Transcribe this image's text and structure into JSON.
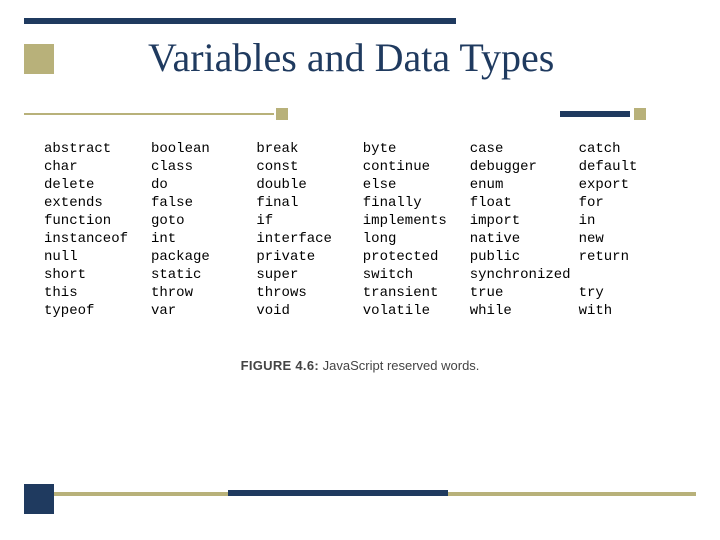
{
  "title": "Variables and Data Types",
  "figure": {
    "label": "FIGURE 4.6:",
    "caption": "JavaScript reserved words."
  },
  "chart_data": {
    "type": "table",
    "title": "JavaScript reserved words",
    "columns": 6,
    "rows": [
      [
        "abstract",
        "boolean",
        "break",
        "byte",
        "case",
        "catch"
      ],
      [
        "char",
        "class",
        "const",
        "continue",
        "debugger",
        "default"
      ],
      [
        "delete",
        "do",
        "double",
        "else",
        "enum",
        "export"
      ],
      [
        "extends",
        "false",
        "final",
        "finally",
        "float",
        "for"
      ],
      [
        "function",
        "goto",
        "if",
        "implements",
        "import",
        "in"
      ],
      [
        "instanceof",
        "int",
        "interface",
        "long",
        "native",
        "new"
      ],
      [
        "null",
        "package",
        "private",
        "protected",
        "public",
        "return"
      ],
      [
        "short",
        "static",
        "super",
        "switch",
        "synchronized",
        ""
      ],
      [
        "this",
        "throw",
        "throws",
        "transient",
        "true",
        "try"
      ],
      [
        "typeof",
        "var",
        "void",
        "volatile",
        "while",
        "with"
      ]
    ]
  },
  "colors": {
    "accent_dark": "#1f3a5f",
    "accent_olive": "#b8b17a"
  }
}
